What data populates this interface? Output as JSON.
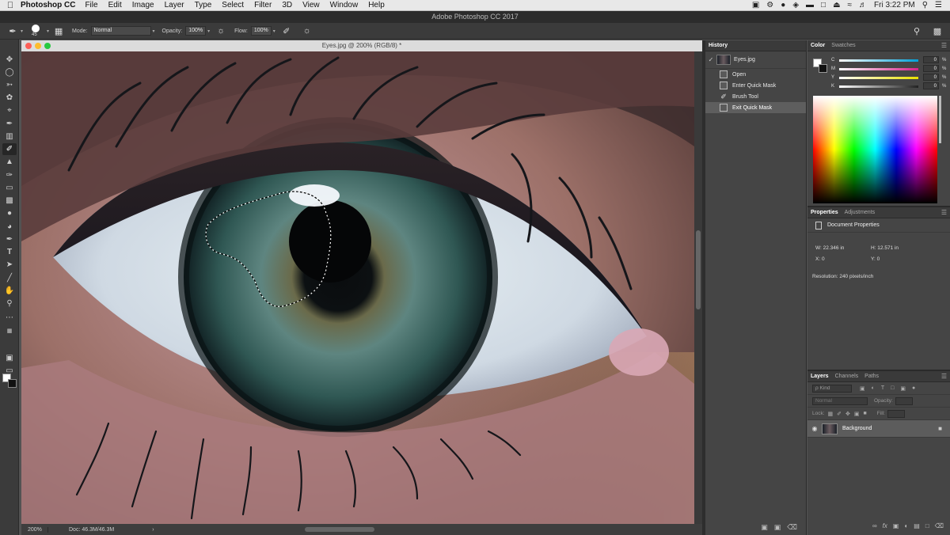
{
  "menubar": {
    "app_name": "Photoshop CC",
    "items": [
      "File",
      "Edit",
      "Image",
      "Layer",
      "Type",
      "Select",
      "Filter",
      "3D",
      "View",
      "Window",
      "Help"
    ],
    "clock": "Fri 3:22 PM"
  },
  "app_title": "Adobe Photoshop CC 2017",
  "options_bar": {
    "brush_size": "45",
    "mode_label": "Mode:",
    "mode_value": "Normal",
    "opacity_label": "Opacity:",
    "opacity_value": "100%",
    "flow_label": "Flow:",
    "flow_value": "100%"
  },
  "document": {
    "tab_title": "Eyes.jpg @ 200% (RGB/8) *",
    "zoom": "200%",
    "doc_size": "Doc: 46.3M/46.3M",
    "status_arrow": "›"
  },
  "history": {
    "title": "History",
    "snapshot": "Eyes.jpg",
    "items": [
      "Open",
      "Enter Quick Mask",
      "Brush Tool",
      "Exit Quick Mask"
    ],
    "selected_index": 3
  },
  "color_panel": {
    "tabs": [
      "Color",
      "Swatches"
    ],
    "channels": [
      {
        "letter": "C",
        "value": "0",
        "unit": "%",
        "color": "#00a0d8"
      },
      {
        "letter": "M",
        "value": "0",
        "unit": "%",
        "color": "#d8208a"
      },
      {
        "letter": "Y",
        "value": "0",
        "unit": "%",
        "color": "#e8e000"
      },
      {
        "letter": "K",
        "value": "0",
        "unit": "%",
        "color": "#222222"
      }
    ]
  },
  "properties_panel": {
    "tabs": [
      "Properties",
      "Adjustments"
    ],
    "section": "Document Properties",
    "width": "W: 22.346 in",
    "height": "H: 12.571 in",
    "x": "X: 0",
    "y": "Y: 0",
    "resolution": "Resolution: 240 pixels/inch"
  },
  "layers_panel": {
    "tabs": [
      "Layers",
      "Channels",
      "Paths"
    ],
    "kind": "ρ Kind",
    "blend_mode": "Normal",
    "opacity_label": "Opacity:",
    "lock_label": "Lock:",
    "fill_label": "Fill:",
    "layer_name": "Background"
  },
  "colors": {
    "accent_selection": "#5e5e5e",
    "panel_bg": "#454545",
    "chrome_bg": "#3b3b3b"
  }
}
